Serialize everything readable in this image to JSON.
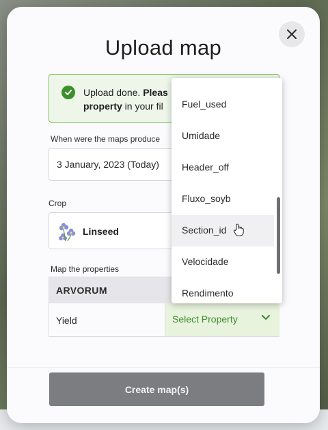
{
  "modal": {
    "title": "Upload map",
    "close_icon": "close-icon"
  },
  "banner": {
    "icon": "check-circle-icon",
    "line1_normal": "Upload done. ",
    "line1_bold": "Pleas",
    "line2_bold": "property",
    "line2_normal": " in your fil"
  },
  "date_section": {
    "label": "When were the maps produce",
    "value": "3 January, 2023 (Today)"
  },
  "crop_section": {
    "label": "Crop",
    "icon": "linseed-flower-icon",
    "value": "Linseed"
  },
  "properties_section": {
    "label": "Map the properties",
    "column_header": "ARVORUM",
    "rows": [
      {
        "label": "Yield",
        "select_placeholder": "Select Property",
        "select_icon": "chevron-down-icon"
      }
    ]
  },
  "dropdown": {
    "options": [
      "Fuel_used",
      "Umidade",
      "Header_off",
      "Fluxo_soyb",
      "Section_id",
      "Velocidade",
      "Rendimento"
    ],
    "hovered": "Section_id"
  },
  "footer": {
    "create_label": "Create map(s)"
  },
  "colors": {
    "accent_green": "#3d8a2e",
    "banner_bg": "#eef6e9",
    "banner_border": "#7fbf5a",
    "disabled_button": "#7b7d80"
  }
}
